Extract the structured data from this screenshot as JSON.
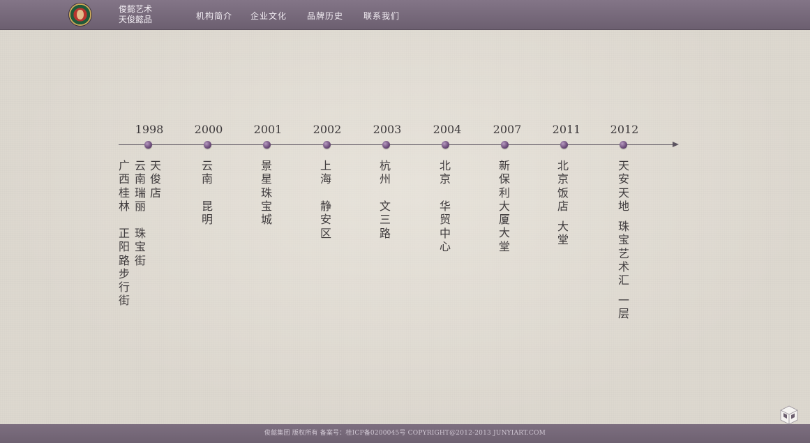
{
  "header": {
    "brand_line1": "俊懿艺术",
    "brand_line2": "天俊懿品",
    "nav": [
      "机构简介",
      "企业文化",
      "品牌历史",
      "联系我们"
    ]
  },
  "timeline": {
    "years": [
      "1998",
      "2000",
      "2001",
      "2002",
      "2003",
      "2004",
      "2007",
      "2011",
      "2012"
    ],
    "columns": [
      "广西桂林",
      "正阳路步行街",
      "云南瑞丽",
      "珠宝街",
      "天俊店",
      "云南",
      "昆明",
      "景星珠宝城",
      "上海",
      "静安区",
      "杭州",
      "文三路",
      "北京",
      "华贸中心",
      "新保利大厦大堂",
      "北京饭店",
      "大堂",
      "天安天地",
      "珠宝艺术汇",
      "一层"
    ]
  },
  "footer": {
    "text": "俊懿集团 版权所有 备案号：桂ICP备0200045号 COPYRIGHT@2012-2013 JUNYIART.COM"
  },
  "colors": {
    "header_bg": "#776a7b",
    "paper_bg": "#ddd8cf",
    "dot": "#6a4a78",
    "text": "#3f3b3d"
  }
}
